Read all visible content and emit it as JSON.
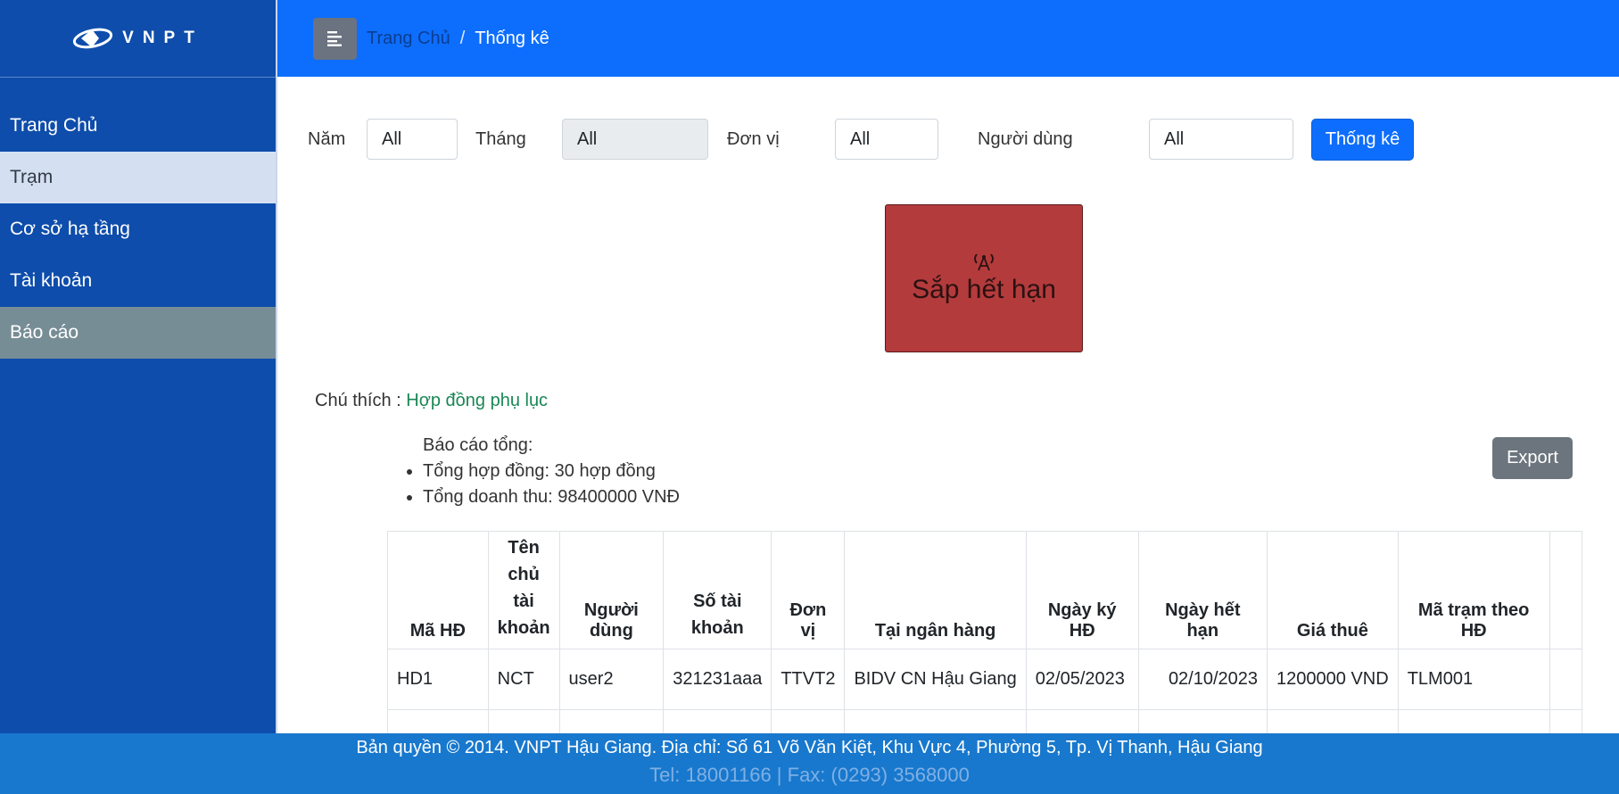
{
  "brand": {
    "logo_text": "VNPT"
  },
  "sidebar": {
    "items": [
      {
        "label": "Trang Chủ"
      },
      {
        "label": "Trạm"
      },
      {
        "label": "Cơ sở hạ tầng"
      },
      {
        "label": "Tài khoản"
      },
      {
        "label": "Báo cáo"
      }
    ]
  },
  "topbar": {
    "menu_icon": "menu-toggle-icon",
    "breadcrumb": {
      "home": "Trang Chủ",
      "separator": "/",
      "current": "Thống kê"
    }
  },
  "filters": {
    "year": {
      "label": "Năm",
      "value": "All"
    },
    "month": {
      "label": "Tháng",
      "value": "All"
    },
    "unit": {
      "label": "Đơn vị",
      "value": "All"
    },
    "user": {
      "label": "Người dùng",
      "value": "All"
    },
    "submit_label": "Thống kê"
  },
  "status_card": {
    "icon": "antenna-icon",
    "label": "Sắp hết hạn",
    "color": "#b43b3c"
  },
  "legend": {
    "label": "Chú thích :",
    "value": "Hợp đồng phụ lục"
  },
  "summary": {
    "title": "Báo cáo tổng:",
    "items": [
      "Tổng hợp đồng: 30 hợp đồng",
      "Tổng doanh thu: 98400000 VNĐ"
    ]
  },
  "export_label": "Export",
  "table": {
    "headers": [
      "Mã HĐ",
      "Tên chủ tài khoản",
      "Người dùng",
      "Số tài khoản",
      "Đơn vị",
      "Tại ngân hàng",
      "Ngày ký HĐ",
      "Ngày hết hạn",
      "Giá thuê",
      "Mã trạm theo HĐ"
    ],
    "rows": [
      [
        "HD1",
        "NCT",
        "user2",
        "321231aaa",
        "TTVT2",
        "BIDV CN Hậu Giang",
        "02/05/2023",
        "02/10/2023",
        "1200000 VND",
        "TLM001"
      ]
    ]
  },
  "footer": {
    "line1": "Bản quyền © 2014. VNPT Hậu Giang. Địa chỉ: Số 61 Võ Văn Kiệt, Khu Vực 4, Phường 5, Tp. Vị Thanh, Hậu Giang",
    "line2": "Tel: 18001166 | Fax: (0293) 3568000"
  },
  "colors": {
    "sidebar": "#0e4dab",
    "topbar": "#0d6efd",
    "footer": "#1878cd",
    "active_item": "#d4e0f2",
    "report_item": "#778d96"
  }
}
